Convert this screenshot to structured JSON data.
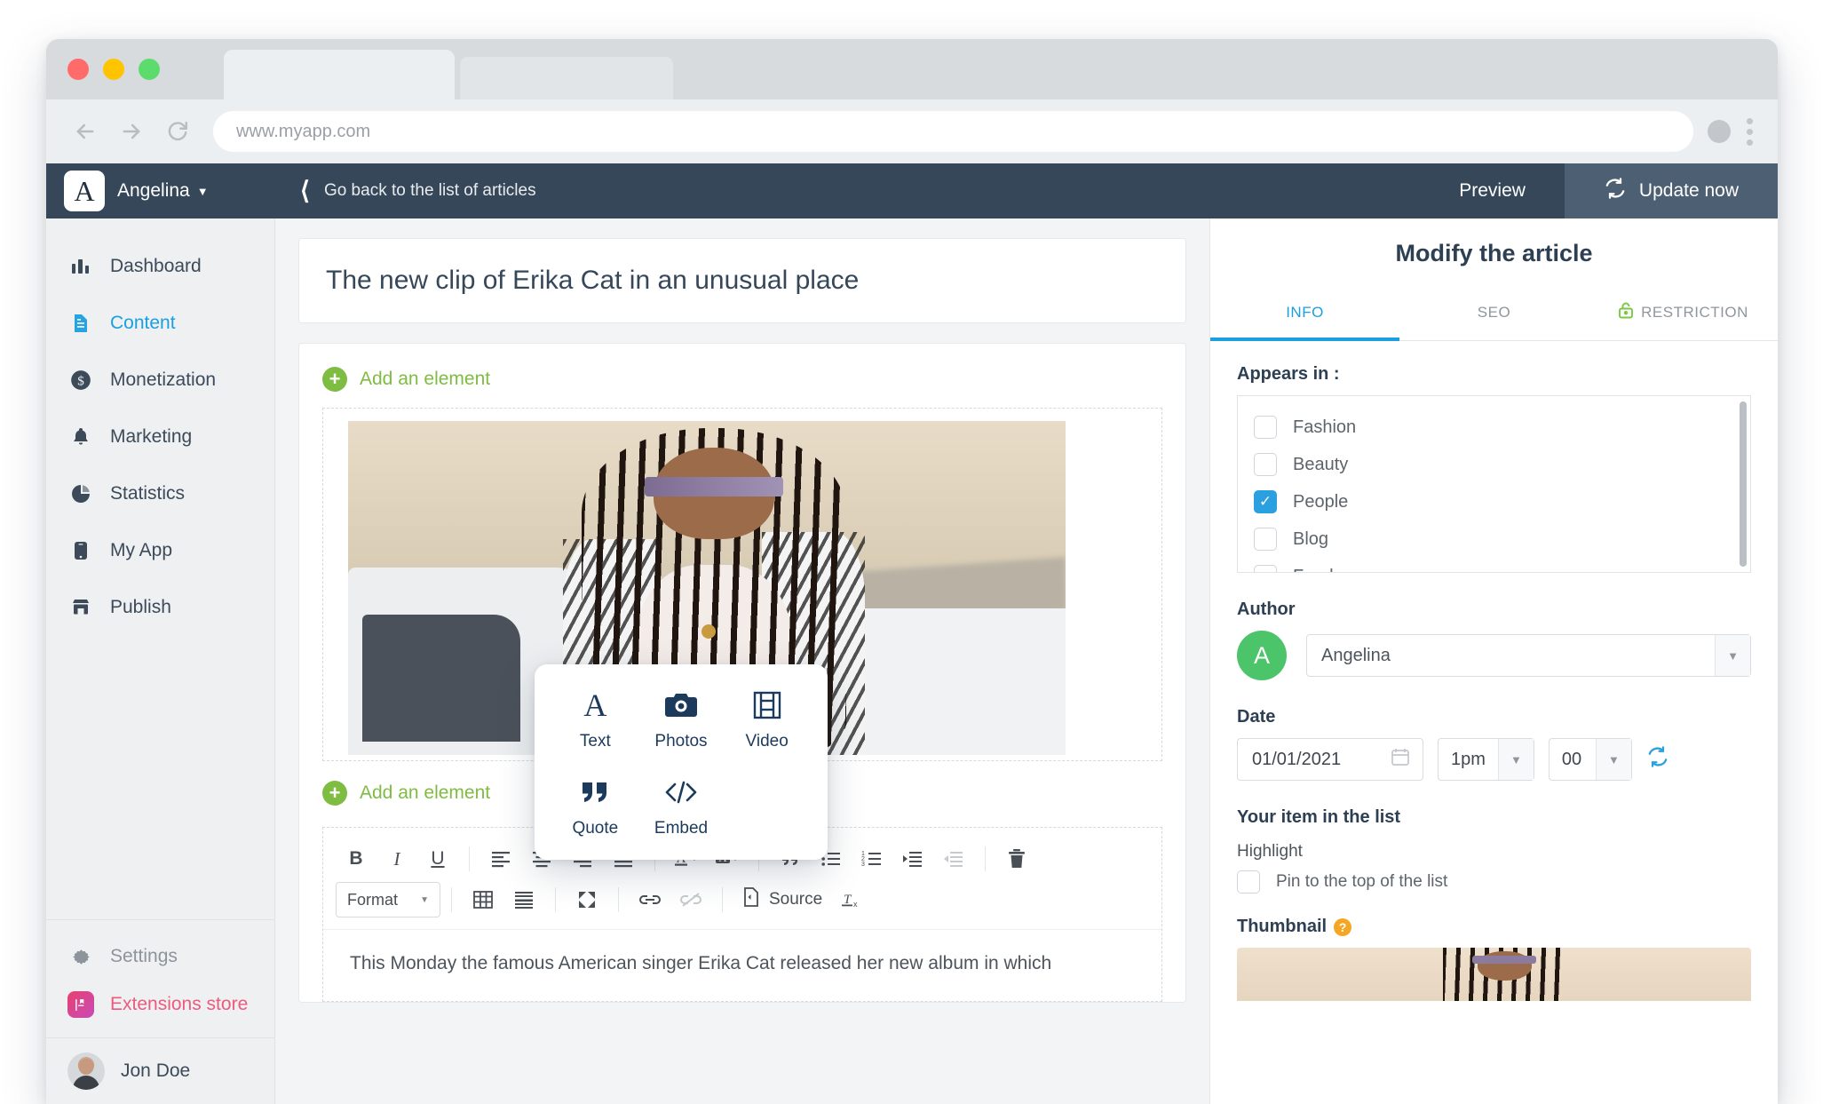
{
  "browser": {
    "url": "www.myapp.com",
    "back_icon": "arrow-left-icon",
    "forward_icon": "arrow-right-icon",
    "reload_icon": "reload-icon",
    "menu_icon": "kebab-menu-icon"
  },
  "topbar": {
    "logo_letter": "A",
    "brand_name": "Angelina",
    "back_link": "Go back to the list of articles",
    "preview_label": "Preview",
    "update_label": "Update now"
  },
  "sidebar": {
    "items": [
      {
        "label": "Dashboard",
        "icon": "bar-chart-icon"
      },
      {
        "label": "Content",
        "icon": "document-icon"
      },
      {
        "label": "Monetization",
        "icon": "dollar-icon"
      },
      {
        "label": "Marketing",
        "icon": "bell-icon"
      },
      {
        "label": "Statistics",
        "icon": "pie-chart-icon"
      },
      {
        "label": "My App",
        "icon": "smartphone-icon"
      },
      {
        "label": "Publish",
        "icon": "store-icon"
      }
    ],
    "active_item": "Content",
    "settings_label": "Settings",
    "extensions_label": "Extensions store",
    "user_name": "Jon Doe"
  },
  "editor": {
    "article_title": "The new clip of Erika Cat in an unusual place",
    "add_element_label": "Add an element",
    "add_element_label_2": "Add an element",
    "body_text": "This Monday the famous American singer Erika Cat released her new album in which",
    "collapse_icon": "chevron-double-right-icon"
  },
  "picker": {
    "items": [
      {
        "label": "Text",
        "icon": "text-a-icon"
      },
      {
        "label": "Photos",
        "icon": "camera-icon"
      },
      {
        "label": "Video",
        "icon": "film-icon"
      },
      {
        "label": "Quote",
        "icon": "quote-icon"
      },
      {
        "label": "Embed",
        "icon": "code-embed-icon"
      }
    ]
  },
  "toolbar": {
    "row1": [
      {
        "label": "B",
        "icon": "bold-icon",
        "dim": false
      },
      {
        "label": "I",
        "icon": "italic-icon",
        "dim": false
      },
      {
        "label": "U",
        "icon": "underline-icon",
        "dim": false
      },
      {
        "label": "",
        "icon": "align-left-icon",
        "dim": false
      },
      {
        "label": "",
        "icon": "align-center-icon",
        "dim": false
      },
      {
        "label": "",
        "icon": "align-right-icon",
        "dim": false
      },
      {
        "label": "",
        "icon": "align-justify-icon",
        "dim": false
      },
      {
        "label": "",
        "icon": "text-color-icon",
        "dim": false
      },
      {
        "label": "",
        "icon": "background-color-icon",
        "dim": false
      },
      {
        "label": "",
        "icon": "blockquote-icon",
        "dim": false
      },
      {
        "label": "",
        "icon": "bulleted-list-icon",
        "dim": false
      },
      {
        "label": "",
        "icon": "numbered-list-icon",
        "dim": false
      },
      {
        "label": "",
        "icon": "increase-indent-icon",
        "dim": false
      },
      {
        "label": "",
        "icon": "decrease-indent-icon",
        "dim": true
      },
      {
        "label": "",
        "icon": "trash-icon",
        "dim": false
      }
    ],
    "format_label": "Format",
    "source_label": "Source",
    "row2_icons": [
      "table-icon",
      "horizontal-rule-icon",
      "maximize-icon",
      "link-icon",
      "unlink-icon",
      "remove-format-icon"
    ]
  },
  "rightpanel": {
    "title": "Modify the article",
    "tabs": [
      {
        "label": "INFO",
        "active": true,
        "icon": ""
      },
      {
        "label": "SEO",
        "active": false,
        "icon": ""
      },
      {
        "label": "RESTRICTION",
        "active": false,
        "icon": "lock-icon"
      }
    ],
    "appears_in_label": "Appears in :",
    "categories": [
      {
        "label": "Fashion",
        "checked": false
      },
      {
        "label": "Beauty",
        "checked": false
      },
      {
        "label": "People",
        "checked": true
      },
      {
        "label": "Blog",
        "checked": false
      },
      {
        "label": "Food",
        "checked": false
      }
    ],
    "author_label": "Author",
    "author_initial": "A",
    "author_value": "Angelina",
    "date_label": "Date",
    "date_value": "01/01/2021",
    "hour_value": "1pm",
    "minute_value": "00",
    "refresh_icon": "refresh-icon",
    "calendar_icon": "calendar-icon",
    "list_section_label": "Your item in the list",
    "highlight_label": "Highlight",
    "pin_label": "Pin to the top of the list",
    "pin_checked": false,
    "thumbnail_label": "Thumbnail",
    "thumbnail_help_icon": "help-icon"
  },
  "colors": {
    "topbar": "#36475a",
    "accent_blue": "#1a9fe0",
    "green": "#7fbc42",
    "pink": "#ec5b7d",
    "author_green": "#4cc46a",
    "check_blue": "#2ba0e0",
    "help_orange": "#f5a623"
  }
}
